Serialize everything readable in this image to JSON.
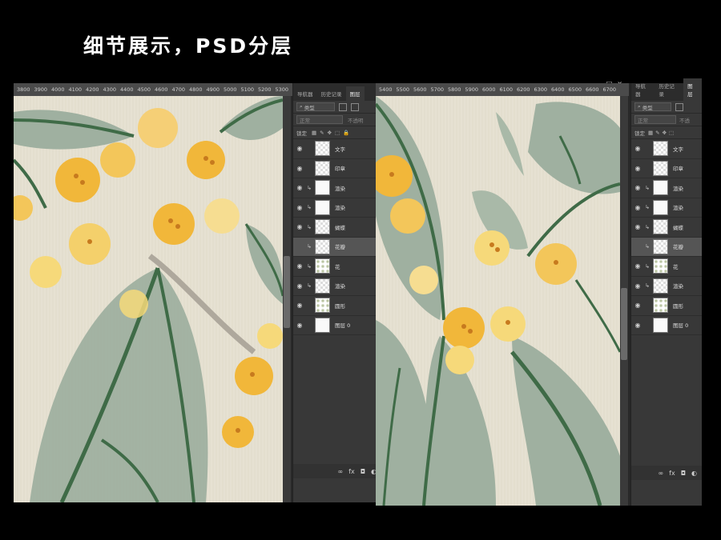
{
  "headline": "细节展示，PSD分层",
  "left_window": {
    "ruler_ticks": [
      "3800",
      "3900",
      "4000",
      "4100",
      "4200",
      "4300",
      "4400",
      "4500",
      "4600",
      "4700",
      "4800",
      "4900",
      "5000",
      "5100",
      "5200",
      "5300"
    ],
    "panel": {
      "tabs": [
        "导航器",
        "历史记录",
        "图层"
      ],
      "active_tab": "图层",
      "filter": "类型",
      "blend": "正常",
      "opacity_label": "不透明",
      "lock_label": "锁定",
      "layers": [
        {
          "name": "文字",
          "thumb": "checker",
          "clip": false,
          "selected": false
        },
        {
          "name": "印章",
          "thumb": "checker",
          "clip": false,
          "selected": false
        },
        {
          "name": "渲染",
          "thumb": "solid",
          "clip": true,
          "selected": false
        },
        {
          "name": "渲染",
          "thumb": "solid",
          "clip": true,
          "selected": false
        },
        {
          "name": "蝴蝶",
          "thumb": "checker",
          "clip": true,
          "selected": false
        },
        {
          "name": "花瓣",
          "thumb": "checker",
          "clip": true,
          "selected": true
        },
        {
          "name": "花",
          "thumb": "flower",
          "clip": true,
          "selected": false
        },
        {
          "name": "渲染",
          "thumb": "checker",
          "clip": true,
          "selected": false
        },
        {
          "name": "圆形",
          "thumb": "flower",
          "clip": false,
          "selected": false
        },
        {
          "name": "图层 0",
          "thumb": "solid",
          "clip": false,
          "selected": false
        }
      ]
    }
  },
  "right_window": {
    "ruler_ticks": [
      "5400",
      "5500",
      "5600",
      "5700",
      "5800",
      "5900",
      "6000",
      "6100",
      "6200",
      "6300",
      "6400",
      "6500",
      "6600",
      "6700"
    ],
    "panel": {
      "tabs": [
        "导航器",
        "历史记录",
        "图层"
      ],
      "active_tab": "图层",
      "filter": "类型",
      "blend": "正常",
      "opacity_label": "不透",
      "lock_label": "锁定",
      "layers": [
        {
          "name": "文字",
          "thumb": "checker",
          "clip": false,
          "selected": false
        },
        {
          "name": "印章",
          "thumb": "checker",
          "clip": false,
          "selected": false
        },
        {
          "name": "渲染",
          "thumb": "solid",
          "clip": true,
          "selected": false
        },
        {
          "name": "渲染",
          "thumb": "solid",
          "clip": true,
          "selected": false
        },
        {
          "name": "蝴蝶",
          "thumb": "checker",
          "clip": true,
          "selected": false
        },
        {
          "name": "花瓣",
          "thumb": "checker",
          "clip": true,
          "selected": true
        },
        {
          "name": "花",
          "thumb": "flower",
          "clip": true,
          "selected": false
        },
        {
          "name": "渲染",
          "thumb": "checker",
          "clip": true,
          "selected": false
        },
        {
          "name": "圆形",
          "thumb": "flower",
          "clip": false,
          "selected": false
        },
        {
          "name": "图层 0",
          "thumb": "solid",
          "clip": false,
          "selected": false
        }
      ]
    }
  },
  "footer_icons": [
    "link-icon",
    "fx-icon",
    "mask-icon",
    "adjustment-icon"
  ],
  "footer_fx": "fx",
  "window_controls": [
    "minimize-icon",
    "maximize-icon",
    "close-icon"
  ],
  "colors": {
    "background": "#000000",
    "canvas": "#e7e2d3",
    "leaf": "#9fb0a0",
    "stem": "#3f6b47",
    "flower": "#f1b73a",
    "flower_light": "#f6d97a"
  }
}
